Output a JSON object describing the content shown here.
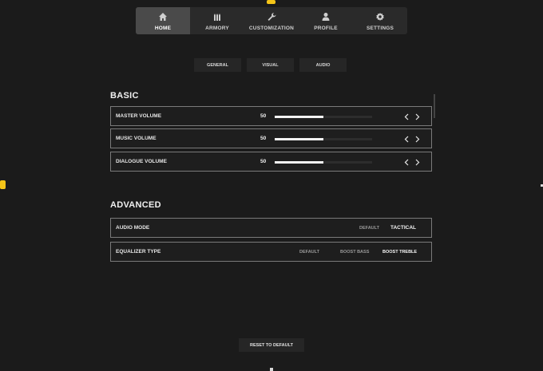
{
  "nav": {
    "items": [
      {
        "label": "HOME",
        "icon": "home-icon"
      },
      {
        "label": "ARMORY",
        "icon": "ammo-icon"
      },
      {
        "label": "CUSTOMIZATION",
        "icon": "wrench-icon"
      },
      {
        "label": "PROFILE",
        "icon": "person-icon"
      },
      {
        "label": "SETTINGS",
        "icon": "gear-icon"
      }
    ],
    "active": "HOME"
  },
  "subtabs": [
    "GENERAL",
    "VISUAL",
    "AUDIO"
  ],
  "basic": {
    "title": "BASIC",
    "rows": [
      {
        "label": "MASTER VOLUME",
        "value": "50",
        "level": 0.5
      },
      {
        "label": "MUSIC VOLUME",
        "value": "50",
        "level": 0.5
      },
      {
        "label": "DIALOGUE VOLUME",
        "value": "50",
        "level": 0.5
      }
    ]
  },
  "advanced": {
    "title": "ADVANCED",
    "audio_mode": {
      "label": "AUDIO MODE",
      "options": [
        "DEFAULT",
        "TACTICAL"
      ],
      "selected": "TACTICAL"
    },
    "equalizer": {
      "label": "EQUALIZER TYPE",
      "options": [
        "DEFAULT",
        "BOOST BASS",
        "BOOST TREBLE"
      ],
      "selected": "BOOST TREBLE"
    }
  },
  "reset_label": "RESET TO DEFAULT",
  "colors": {
    "background": "#1b1b1b",
    "accent": "#f5c518",
    "active_tab": "#4a4a4a"
  }
}
